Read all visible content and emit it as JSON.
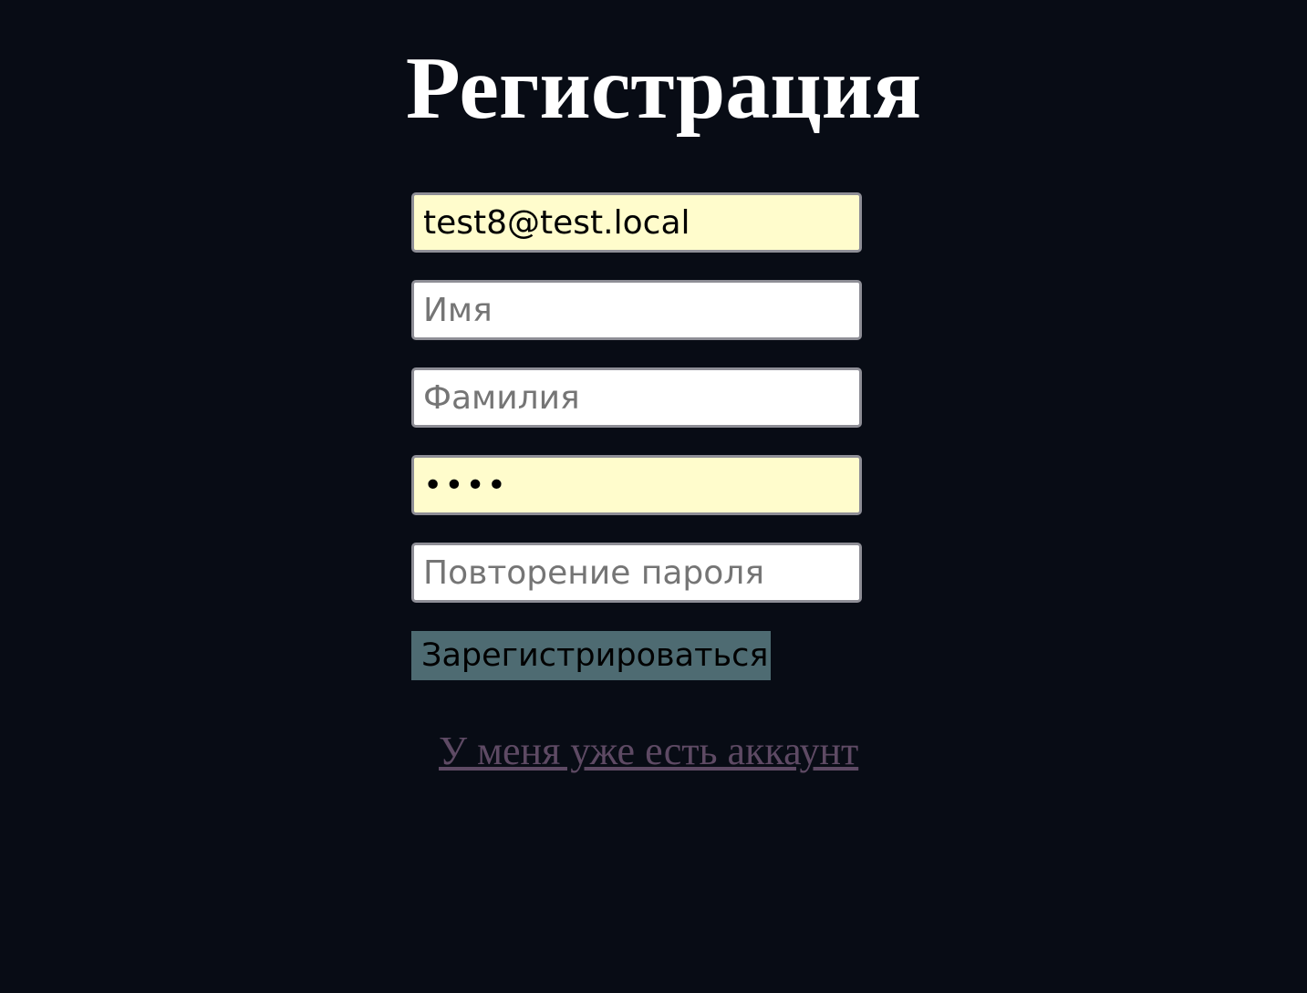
{
  "page": {
    "title": "Регистрация"
  },
  "form": {
    "email": {
      "value": "test8@test.local"
    },
    "first_name": {
      "placeholder": "Имя"
    },
    "last_name": {
      "placeholder": "Фамилия"
    },
    "password": {
      "value": "1234"
    },
    "password_repeat": {
      "placeholder": "Повторение пароля"
    },
    "submit_label": "Зарегистрироваться"
  },
  "login_link": {
    "label": "У меня уже есть аккаунт"
  },
  "colors": {
    "background": "#080c15",
    "autofill": "#fffccc",
    "button": "#4e6b72",
    "link": "#5e4a64"
  }
}
